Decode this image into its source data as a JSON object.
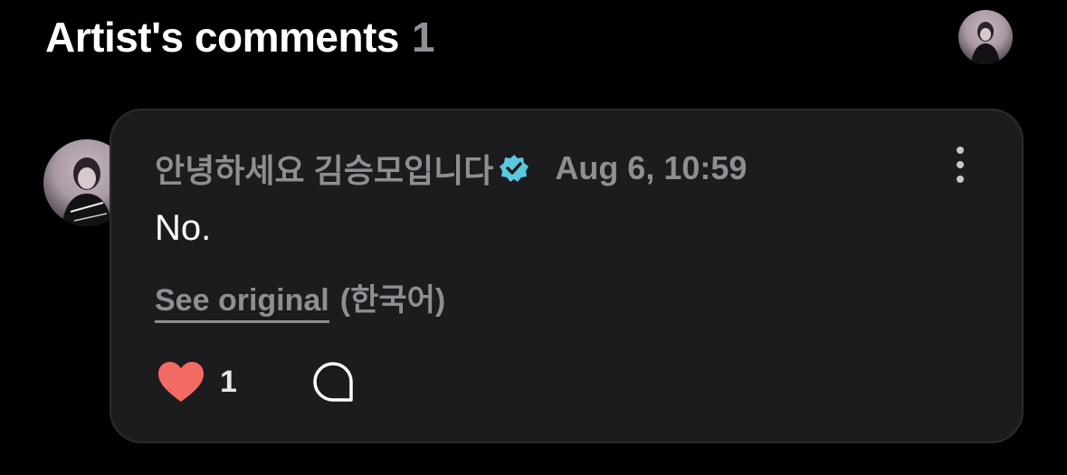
{
  "header": {
    "title": "Artist's comments",
    "count": "1"
  },
  "comment": {
    "username": "안녕하세요 김승모입니다",
    "verified_icon": "verified-badge-icon",
    "timestamp": "Aug 6, 10:59",
    "text": "No.",
    "see_original": "See original",
    "language": "(한국어)",
    "likes": "1"
  },
  "colors": {
    "background": "#000000",
    "card": "#1c1c1e",
    "secondary_text": "#8e8e93",
    "heart": "#f26b64",
    "verified": "#5ac8e0"
  }
}
